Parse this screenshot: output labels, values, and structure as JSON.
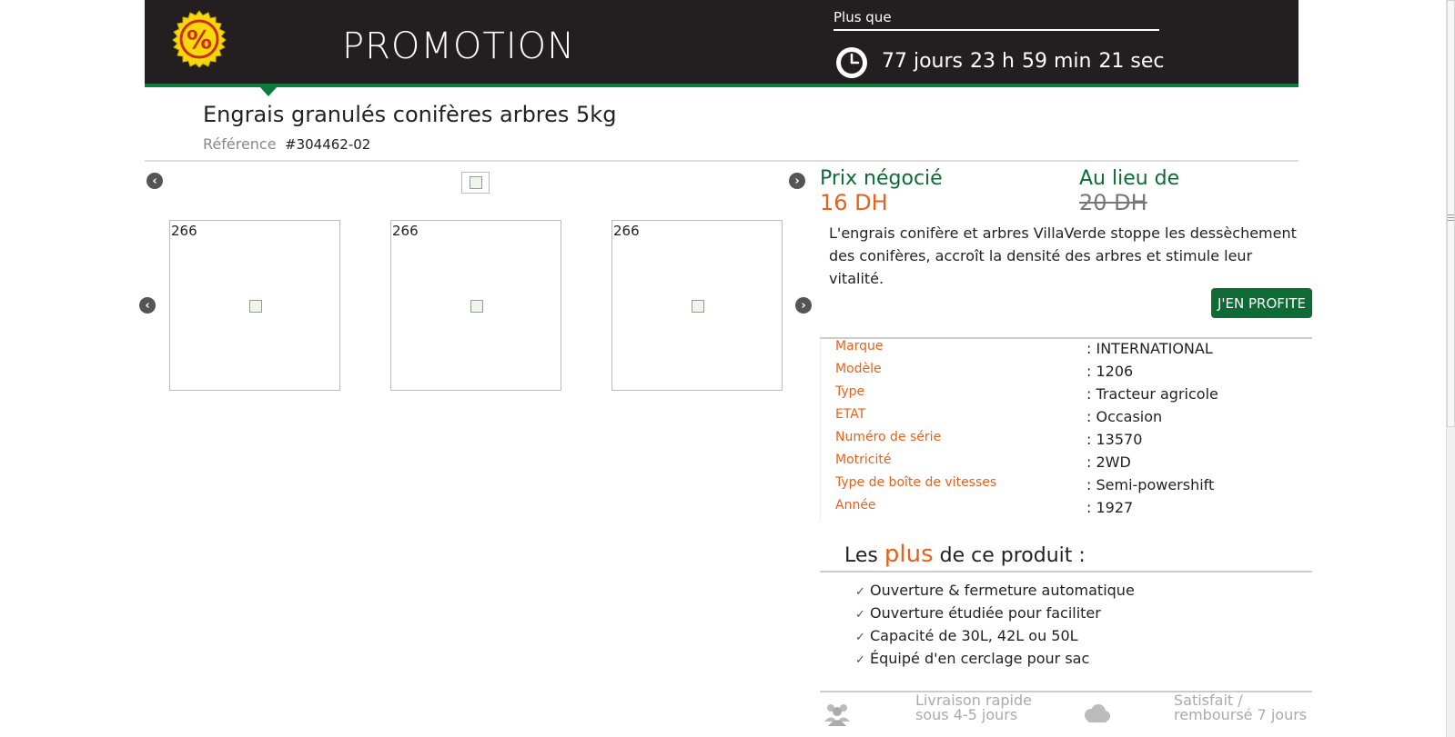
{
  "header": {
    "title": "PROMOTION",
    "countdown_label": "Plus que",
    "countdown": {
      "days": "77 jours",
      "hours": "23 h",
      "minutes": "59 min",
      "seconds": "21 sec"
    },
    "badge_icon": "percent-badge-icon",
    "clock_icon": "clock-icon"
  },
  "product": {
    "title": "Engrais granulés conifères arbres 5kg",
    "reference_label": "Référence",
    "reference_value": "#304462-02"
  },
  "gallery": {
    "prev_icon": "chevron-left-icon",
    "next_icon": "chevron-right-icon",
    "thumbnails": [
      {
        "label": "266"
      },
      {
        "label": "266"
      },
      {
        "label": "266"
      }
    ]
  },
  "pricing": {
    "price_label": "Prix négocié",
    "price_value": "16 DH",
    "old_label": "Au lieu de",
    "old_value": "20 DH"
  },
  "description": "L'engrais conifère et arbres VillaVerde stoppe les dessèchement des conifères, accroît la densité des arbres et stimule leur vitalité.",
  "cta_label": "J'EN PROFITE",
  "specs": [
    {
      "key": "Marque",
      "value": ": INTERNATIONAL"
    },
    {
      "key": "Modèle",
      "value": ": 1206"
    },
    {
      "key": "Type",
      "value": ": Tracteur agricole"
    },
    {
      "key": "ETAT",
      "value": ": Occasion"
    },
    {
      "key": "Numéro de série",
      "value": ": 13570"
    },
    {
      "key": "Motricité",
      "value": ": 2WD"
    },
    {
      "key": "Type de boîte de vitesses",
      "value": ": Semi-powershift"
    },
    {
      "key": "Année",
      "value": ": 1927"
    }
  ],
  "plus": {
    "heading_before": "Les",
    "heading_accent": "plus",
    "heading_after": "de ce produit :",
    "items": [
      "Ouverture & fermeture automatique",
      "Ouverture étudiée pour faciliter",
      "Capacité de 30L, 42L ou 50L",
      "Équipé d'en cerclage pour sac"
    ]
  },
  "bottom": {
    "delivery_line1": "Livraison rapide",
    "delivery_line2": "sous 4-5 jours",
    "satisfied_line1": "Satisfait /",
    "satisfied_line2": "remboursé 7 jours"
  },
  "colors": {
    "header_bg": "#231f20",
    "brand_green": "#0e6b35",
    "accent_orange": "#e8611c"
  }
}
